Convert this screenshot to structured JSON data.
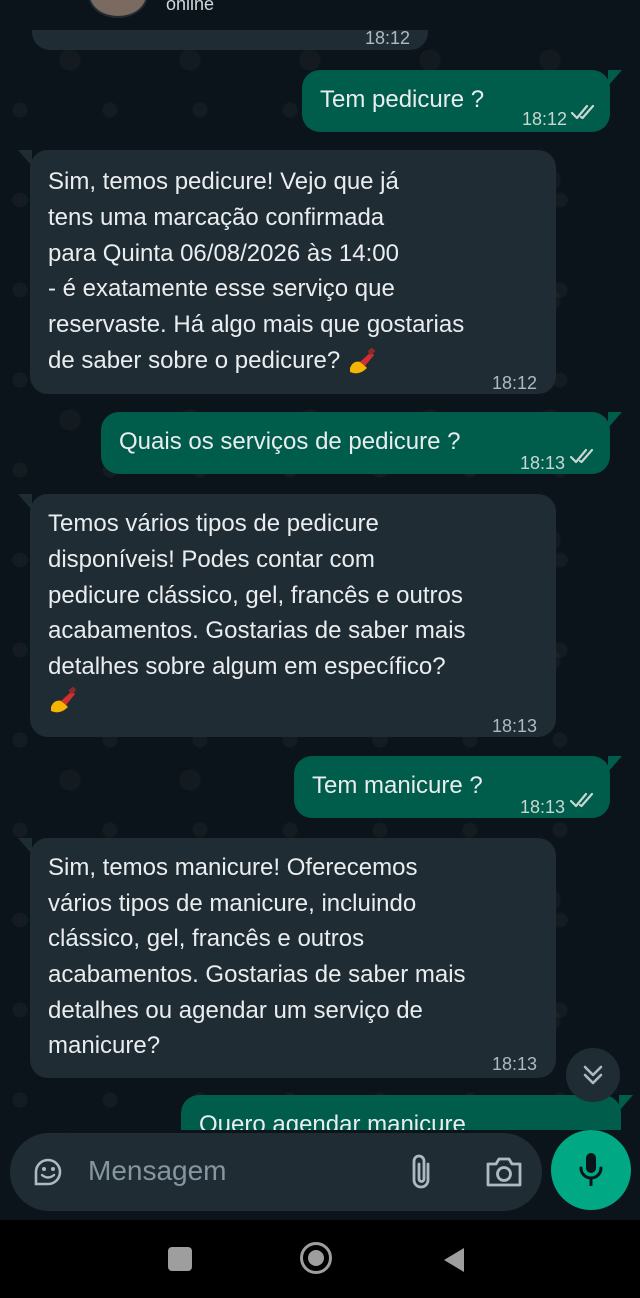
{
  "header": {
    "status": "online",
    "top_time": "18:12"
  },
  "messages": [
    {
      "dir": "out",
      "text": "Tem pedicure ?",
      "time": "18:12"
    },
    {
      "dir": "in",
      "lines": [
        "Sim, temos pedicure! Vejo que já",
        "tens uma marcação confirmada",
        "para Quinta 06/08/2026 às 14:00",
        "- é exatamente esse serviço que",
        "reservaste. Há algo mais que gostarias",
        "de saber sobre o pedicure?"
      ],
      "time": "18:12"
    },
    {
      "dir": "out",
      "text": "Quais os serviços de pedicure ?",
      "time": "18:13"
    },
    {
      "dir": "in",
      "lines": [
        "Temos vários tipos de pedicure",
        "disponíveis! Podes contar com",
        "pedicure clássico, gel, francês e outros",
        "acabamentos. Gostarias de saber mais",
        "detalhes sobre algum em específico?"
      ],
      "time": "18:13"
    },
    {
      "dir": "out",
      "text": "Tem manicure ?",
      "time": "18:13"
    },
    {
      "dir": "in",
      "lines": [
        "Sim, temos manicure! Oferecemos",
        "vários tipos de manicure, incluindo",
        "clássico, gel, francês e outros",
        "acabamentos. Gostarias de saber mais",
        "detalhes ou agendar um serviço de",
        "manicure?"
      ],
      "time": "18:13"
    },
    {
      "dir": "out",
      "text": "Quero agendar manicure"
    }
  ],
  "composer": {
    "placeholder": "Mensagem"
  },
  "icons": {
    "sticker": "sticker-icon",
    "attach": "paperclip-icon",
    "camera": "camera-icon",
    "mic": "microphone-icon",
    "scroll": "double-chevron-down-icon",
    "ticks": "double-check-icon",
    "nail_polish": "nail-polish-emoji"
  },
  "colors": {
    "incoming": "#202c33",
    "outgoing": "#005c4b",
    "accent": "#00a884",
    "background": "#0b141a"
  }
}
